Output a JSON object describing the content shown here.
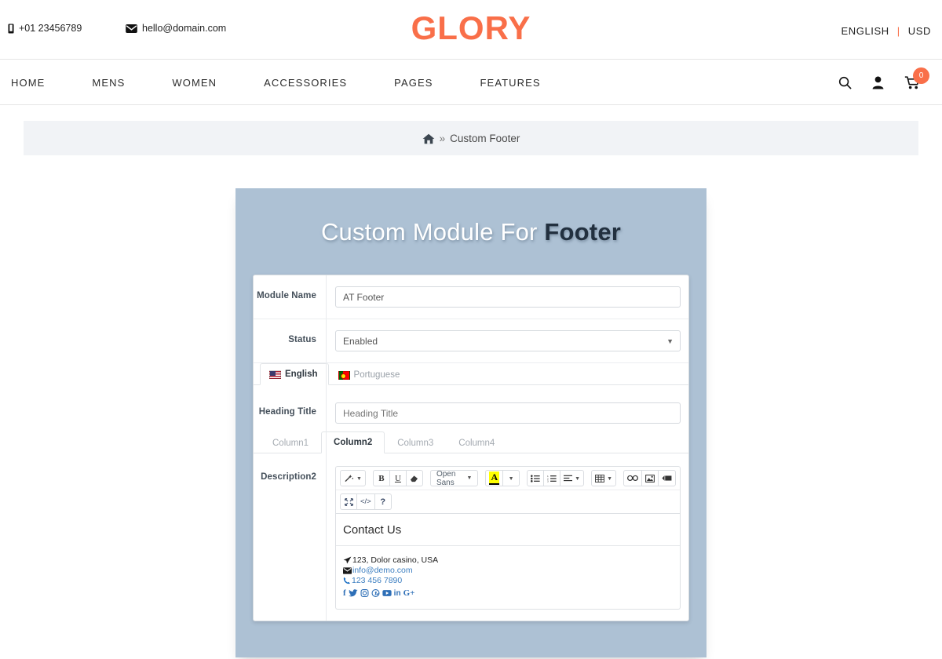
{
  "header": {
    "phone": "+01 23456789",
    "email": "hello@domain.com",
    "logo": "GLORY",
    "language": "ENGLISH",
    "separator": "|",
    "currency": "USD"
  },
  "nav": {
    "links": [
      {
        "label": "HOME"
      },
      {
        "label": "MENS"
      },
      {
        "label": "WOMEN"
      },
      {
        "label": "ACCESSORIES"
      },
      {
        "label": "PAGES"
      },
      {
        "label": "FEATURES"
      }
    ],
    "cart_count": "0"
  },
  "breadcrumb": {
    "separator": "»",
    "current": "Custom Footer"
  },
  "panel": {
    "title_light": "Custom Module For",
    "title_bold": "Footer"
  },
  "form": {
    "module_name": {
      "label": "Module Name",
      "value": "AT Footer"
    },
    "status": {
      "label": "Status",
      "value": "Enabled"
    },
    "language_tabs": [
      {
        "label": "English",
        "flag": "flag-us",
        "active": true
      },
      {
        "label": "Portuguese",
        "flag": "flag-pt",
        "active": false
      }
    ],
    "heading_title": {
      "label": "Heading Title",
      "placeholder": "Heading Title",
      "value": ""
    },
    "column_tabs": [
      {
        "label": "Column1",
        "active": false
      },
      {
        "label": "Column2",
        "active": true
      },
      {
        "label": "Column3",
        "active": false
      },
      {
        "label": "Column4",
        "active": false
      }
    ],
    "description": {
      "label": "Description2"
    }
  },
  "editor": {
    "toolbar_row1": [
      {
        "name": "magic-wand-icon",
        "glyph": "✦",
        "caret": true
      },
      {
        "name": "bold-icon",
        "glyph": "B",
        "caret": false
      },
      {
        "name": "underline-icon",
        "glyph": "U",
        "caret": false
      },
      {
        "name": "eraser-icon",
        "glyph": "◰",
        "caret": false
      },
      {
        "name": "font-family-select",
        "glyph": "Open Sans",
        "caret": true
      },
      {
        "name": "font-color-icon",
        "glyph": "A",
        "caret": false
      },
      {
        "name": "font-color-caret",
        "glyph": "",
        "caret": true
      },
      {
        "name": "unordered-list-icon",
        "glyph": "≣",
        "caret": false
      },
      {
        "name": "ordered-list-icon",
        "glyph": "≣",
        "caret": false
      },
      {
        "name": "paragraph-align-icon",
        "glyph": "≡",
        "caret": true
      },
      {
        "name": "table-icon",
        "glyph": "⊞",
        "caret": true
      },
      {
        "name": "link-icon",
        "glyph": "⚭",
        "caret": false
      },
      {
        "name": "image-icon",
        "glyph": "▣",
        "caret": false
      },
      {
        "name": "video-icon",
        "glyph": "▶",
        "caret": false
      }
    ],
    "toolbar_row2": [
      {
        "name": "fullscreen-icon",
        "glyph": "⤢"
      },
      {
        "name": "code-view-icon",
        "glyph": "</>"
      },
      {
        "name": "help-icon",
        "glyph": "?"
      }
    ],
    "font_name": "Open Sans",
    "content": {
      "heading": "Contact Us",
      "address": "123, Dolor casino, USA",
      "email": "info@demo.com",
      "phone": "123 456 7890",
      "socials": [
        "facebook",
        "twitter",
        "instagram",
        "pinterest",
        "youtube",
        "linkedin",
        "google-plus"
      ],
      "social_glyphs": [
        "f",
        "🐦",
        "◎",
        "Ⓟ",
        "▶",
        "in",
        "G+"
      ]
    }
  },
  "colors": {
    "brand": "#f96f49",
    "panel_bg": "#adc1d4",
    "title_bold": "#22303f",
    "link": "#3d7fc1",
    "highlight": "#ffff00"
  }
}
